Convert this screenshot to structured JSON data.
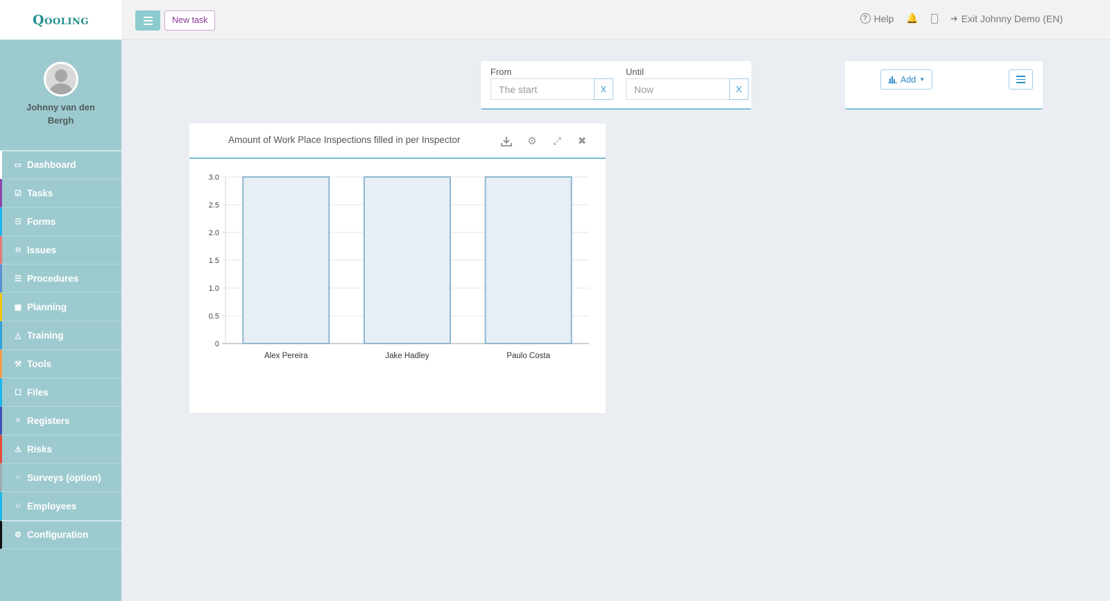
{
  "app": {
    "logo": "Qooling"
  },
  "user": {
    "name": "Johnny van den Bergh"
  },
  "sidebar": {
    "items": [
      {
        "label": "Dashboard",
        "icon": "monitor-icon",
        "color": "#ffffff"
      },
      {
        "label": "Tasks",
        "icon": "checkbox-icon",
        "color": "#8e44ad"
      },
      {
        "label": "Forms",
        "icon": "document-icon",
        "color": "#1ab7ea"
      },
      {
        "label": "Issues",
        "icon": "bell-icon",
        "color": "#e9787a"
      },
      {
        "label": "Procedures",
        "icon": "list-icon",
        "color": "#5b8fd6"
      },
      {
        "label": "Planning",
        "icon": "calendar-icon",
        "color": "#f1c40f"
      },
      {
        "label": "Training",
        "icon": "graduation-cap-icon",
        "color": "#2ea2d8"
      },
      {
        "label": "Tools",
        "icon": "wrench-icon",
        "color": "#f39c4a"
      },
      {
        "label": "Files",
        "icon": "file-icon",
        "color": "#1ab7ea"
      },
      {
        "label": "Registers",
        "icon": "register-icon",
        "color": "#3f51b5"
      },
      {
        "label": "Risks",
        "icon": "warning-icon",
        "color": "#e74c3c"
      },
      {
        "label": "Surveys (option)",
        "icon": "speech-bubble-icon",
        "color": "#a0aab0"
      },
      {
        "label": "Employees",
        "icon": "users-icon",
        "color": "#1ab7ea"
      },
      {
        "label": "Configuration",
        "icon": "gear-icon",
        "color": "#111111"
      }
    ]
  },
  "topbar": {
    "new_task": "New task",
    "help": "Help",
    "exit": "Exit Johnny Demo (EN)"
  },
  "filters": {
    "from_label": "From",
    "from_placeholder": "The start",
    "until_label": "Until",
    "until_placeholder": "Now",
    "clear": "X"
  },
  "toolbar": {
    "add_label": "Add"
  },
  "widget": {
    "title": "Amount of Work Place Inspections filled in per Inspector"
  },
  "chart_data": {
    "type": "bar",
    "categories": [
      "Alex Pereira",
      "Jake Hadley",
      "Paulo Costa"
    ],
    "values": [
      3,
      3,
      3
    ],
    "ylim": [
      0,
      3
    ],
    "yticks": [
      "0",
      "0.5",
      "1.0",
      "1.5",
      "2.0",
      "2.5",
      "3.0"
    ],
    "grid": true,
    "bar_fill": "#e6eff4",
    "bar_stroke": "#8db7d1"
  }
}
